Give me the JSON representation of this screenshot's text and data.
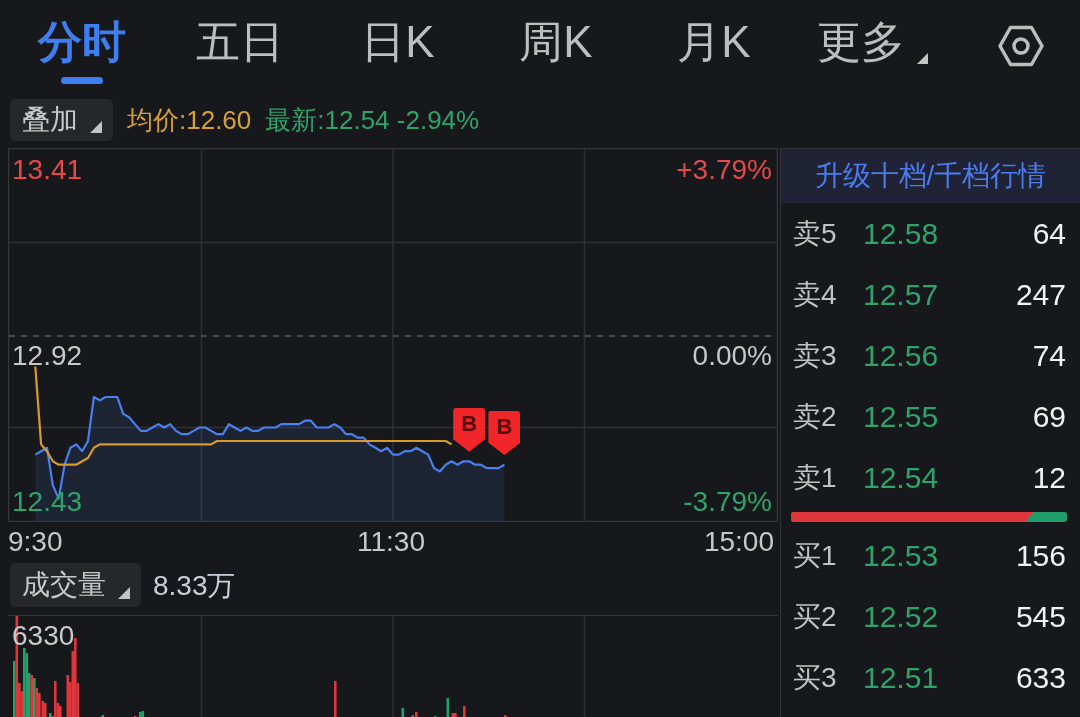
{
  "tabs": [
    {
      "label": "分时",
      "selected": true,
      "kind": "tab"
    },
    {
      "label": "五日",
      "selected": false,
      "kind": "tab"
    },
    {
      "label": "日K",
      "selected": false,
      "kind": "tab"
    },
    {
      "label": "周K",
      "selected": false,
      "kind": "tab"
    },
    {
      "label": "月K",
      "selected": false,
      "kind": "tab"
    },
    {
      "label": "更多",
      "selected": false,
      "kind": "menu"
    }
  ],
  "overlay_button": {
    "label": "叠加"
  },
  "price_summary": {
    "average": "均价:12.60",
    "latest": "最新:12.54 -2.94%"
  },
  "price_chart": {
    "chart_data": [
      {
        "type": "line",
        "categories": [
          "9:30",
          null,
          null,
          null,
          null,
          null,
          null,
          null,
          null,
          null,
          null,
          null,
          null,
          null,
          null,
          null,
          null,
          null,
          null,
          null,
          null,
          null,
          null,
          null,
          null,
          null,
          null,
          null,
          null,
          null,
          null,
          null,
          null,
          null,
          null,
          null,
          null,
          null,
          null,
          null,
          null,
          null,
          null,
          null,
          null,
          null,
          null,
          null,
          null,
          null,
          null,
          null,
          null,
          null,
          null,
          null,
          null,
          null,
          null,
          null,
          "11:30",
          null,
          null,
          null,
          null,
          null,
          null,
          null,
          null,
          null,
          null,
          null,
          null,
          null,
          null,
          null,
          null,
          null,
          null,
          null,
          null,
          null,
          null,
          null,
          null,
          null,
          null,
          null,
          null,
          null,
          null,
          null,
          null,
          null,
          null,
          null,
          null,
          null,
          null,
          null,
          null,
          null,
          null,
          null,
          null,
          null,
          null,
          null,
          null,
          null,
          null,
          null,
          null,
          null,
          null,
          null,
          null,
          null,
          null,
          null,
          "15:00"
        ],
        "series": [
          {
            "type": "area",
            "color": "#4a7ff0",
            "values": [
              12.57,
              12.58,
              12.59,
              12.48,
              12.44,
              12.54,
              12.59,
              12.6,
              12.58,
              12.61,
              12.74,
              12.73,
              12.74,
              12.74,
              12.74,
              12.69,
              12.68,
              12.66,
              12.64,
              12.64,
              12.65,
              12.66,
              12.65,
              12.66,
              12.64,
              12.63,
              12.63,
              12.64,
              12.65,
              12.65,
              12.64,
              12.63,
              12.63,
              12.66,
              12.65,
              12.64,
              12.65,
              12.64,
              12.64,
              12.65,
              12.65,
              12.65,
              12.66,
              12.66,
              12.66,
              12.66,
              12.67,
              12.67,
              12.65,
              12.65,
              12.65,
              12.66,
              12.65,
              12.63,
              12.63,
              12.62,
              12.62,
              12.6,
              12.59,
              12.58,
              12.59,
              12.57,
              12.57,
              12.58,
              12.58,
              12.59,
              12.58,
              12.57,
              12.53,
              12.52,
              12.54,
              12.55,
              12.54,
              12.55,
              12.55,
              12.54,
              12.54,
              12.53,
              12.53,
              12.53,
              12.54,
              null,
              null,
              null,
              null,
              null,
              null,
              null,
              null,
              null,
              null,
              null,
              null,
              null,
              null,
              null,
              null,
              null,
              null,
              null,
              null,
              null,
              null,
              null,
              null,
              null,
              null,
              null,
              null,
              null,
              null,
              null,
              null,
              null,
              null,
              null,
              null,
              null,
              null,
              null,
              null
            ]
          },
          {
            "type": "line",
            "color": "#d79a2b",
            "values": [
              12.83,
              12.6,
              12.58,
              12.55,
              12.54,
              12.54,
              12.54,
              12.54,
              12.55,
              12.56,
              12.59,
              12.6,
              12.6,
              12.6,
              12.6,
              12.6,
              12.6,
              12.6,
              12.6,
              12.6,
              12.6,
              12.6,
              12.6,
              12.6,
              12.6,
              12.6,
              12.6,
              12.6,
              12.6,
              12.6,
              12.6,
              12.61,
              12.61,
              12.61,
              12.61,
              12.61,
              12.61,
              12.61,
              12.61,
              12.61,
              12.61,
              12.61,
              12.61,
              12.61,
              12.61,
              12.61,
              12.61,
              12.61,
              12.61,
              12.61,
              12.61,
              12.61,
              12.61,
              12.61,
              12.61,
              12.61,
              12.61,
              12.61,
              12.61,
              12.61,
              12.61,
              12.61,
              12.61,
              12.61,
              12.61,
              12.61,
              12.61,
              12.61,
              12.61,
              12.61,
              12.61,
              12.6,
              null,
              null,
              null,
              null,
              null,
              null,
              null,
              null,
              null,
              null,
              null,
              null,
              null,
              null,
              null,
              null,
              null,
              null,
              null,
              null,
              null,
              null,
              null,
              null,
              null,
              null,
              null,
              null,
              null,
              null,
              null,
              null,
              null,
              null,
              null,
              null,
              null,
              null,
              null,
              null,
              null,
              null,
              null,
              null,
              null,
              null,
              null,
              null,
              null
            ]
          }
        ],
        "ylim": [
          12.43,
          13.41
        ],
        "yticks": [
          {
            "value": 12.43,
            "label": "12.43"
          },
          {
            "value": 13.41,
            "label": "13.41"
          }
        ],
        "y2lim": [
          -3.79,
          3.79
        ],
        "y2ticks": [
          {
            "value": -3.79,
            "label": "-3.79%"
          },
          {
            "value": 3.79,
            "label": "+3.79%"
          }
        ],
        "grid": true,
        "ref_lines": [
          {
            "axis": "y",
            "value": 12.92,
            "label": "12.92",
            "line_style": "dashed"
          }
        ],
        "annotations": [
          "0.00%"
        ]
      }
    ],
    "trade_marks": [
      {
        "label": "B"
      },
      {
        "label": "B"
      }
    ]
  },
  "volume": {
    "button": "成交量",
    "total": "8.33万",
    "max_label": "6330"
  },
  "order_book": {
    "upgrade_link": "升级十档/千档行情",
    "asks": [
      {
        "label": "卖5",
        "price": "12.58",
        "volume": "64"
      },
      {
        "label": "卖4",
        "price": "12.57",
        "volume": "247"
      },
      {
        "label": "卖3",
        "price": "12.56",
        "volume": "74"
      },
      {
        "label": "卖2",
        "price": "12.55",
        "volume": "69"
      },
      {
        "label": "卖1",
        "price": "12.54",
        "volume": "12"
      }
    ],
    "balance": {
      "level": 0.88
    },
    "bids": [
      {
        "label": "买1",
        "price": "12.53",
        "volume": "156"
      },
      {
        "label": "买2",
        "price": "12.52",
        "volume": "545"
      },
      {
        "label": "买3",
        "price": "12.51",
        "volume": "633"
      }
    ]
  }
}
